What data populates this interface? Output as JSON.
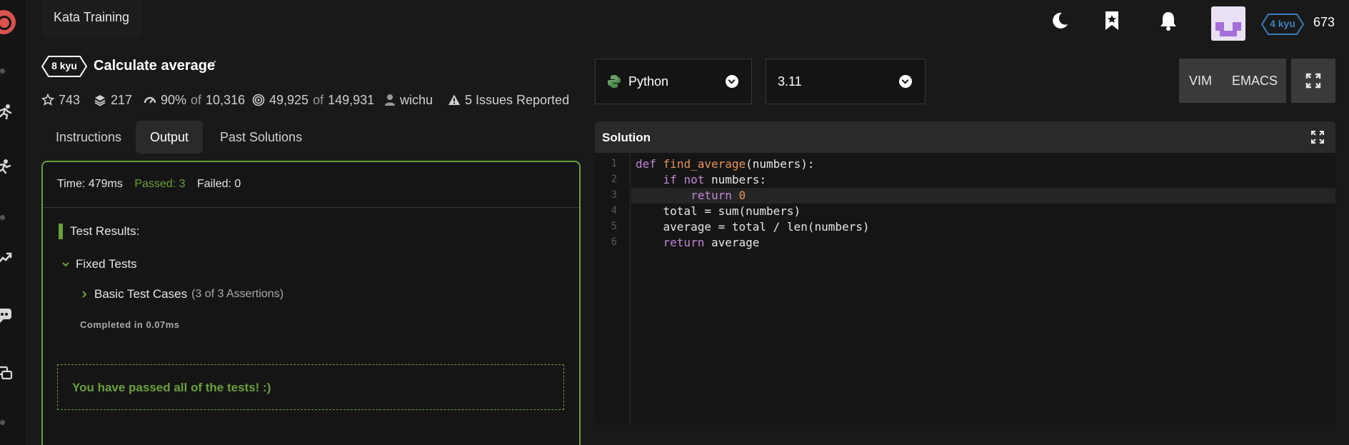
{
  "header": {
    "kata_training": "Kata Training",
    "rank": "4 kyu",
    "honor": "673"
  },
  "kata": {
    "kyu": "8 kyu",
    "title": "Calculate average",
    "stats": {
      "stars": "743",
      "collections": "217",
      "satisfaction": "90%",
      "satisfaction_of": "of",
      "votes": "10,316",
      "completed": "49,925",
      "completed_of": "of",
      "attempts": "149,931",
      "author": "wichu",
      "issues": "5 Issues Reported"
    }
  },
  "tabs": [
    {
      "label": "Instructions",
      "active": false
    },
    {
      "label": "Output",
      "active": true
    },
    {
      "label": "Past Solutions",
      "active": false
    }
  ],
  "output": {
    "time": "Time: 479ms",
    "passed": "Passed: 3",
    "failed": "Failed: 0",
    "results_title": "Test Results:",
    "fixed_tests": "Fixed Tests",
    "basic_cases": "Basic Test Cases",
    "assertions": "(3 of 3 Assertions)",
    "completed_in": "Completed in 0.07ms",
    "pass_message": "You have passed all of the tests! :)"
  },
  "editor": {
    "language": "Python",
    "version": "3.11",
    "vim": "VIM",
    "emacs": "EMACS",
    "solution_title": "Solution",
    "line_numbers": [
      "1",
      "2",
      "3",
      "4",
      "5",
      "6"
    ],
    "current_line": 3
  },
  "colors": {
    "accent_green": "#6aa03b",
    "rank_blue": "#3c7ebb",
    "keyword": "#c186d4",
    "function": "#e6935a"
  },
  "icons": {
    "theme": "moon-icon",
    "bookmarks": "bookmark-star-icon",
    "notifications": "bell-icon",
    "fullscreen": "expand-icon"
  }
}
